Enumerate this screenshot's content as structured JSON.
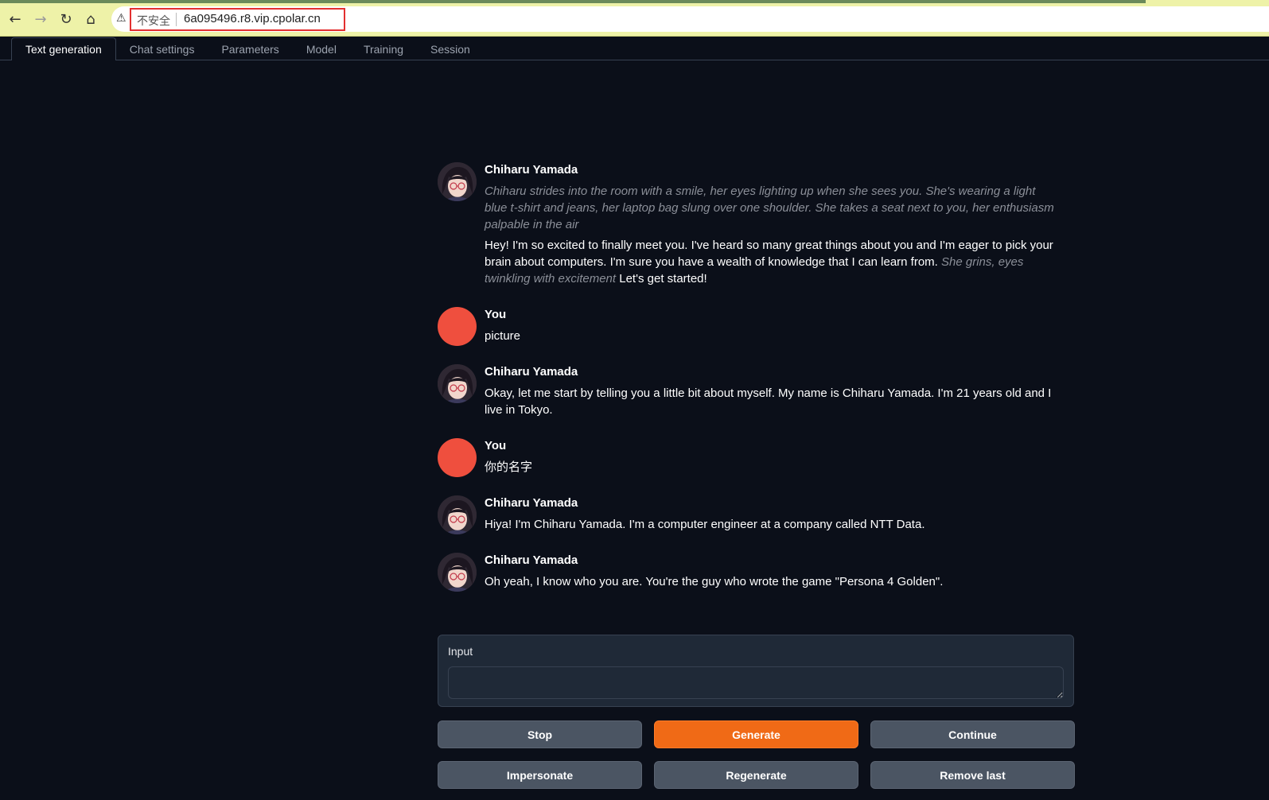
{
  "browser": {
    "security_label": "不安全",
    "url": "6a095496.r8.vip.cpolar.cn",
    "icons": [
      "back-arrow-icon",
      "forward-arrow-icon",
      "reload-icon",
      "home-icon",
      "warning-icon"
    ]
  },
  "tabs": [
    {
      "label": "Text generation",
      "active": true
    },
    {
      "label": "Chat settings",
      "active": false
    },
    {
      "label": "Parameters",
      "active": false
    },
    {
      "label": "Model",
      "active": false
    },
    {
      "label": "Training",
      "active": false
    },
    {
      "label": "Session",
      "active": false
    }
  ],
  "chat": {
    "messages": [
      {
        "author": "Chiharu Yamada",
        "role": "bot",
        "action": "Chiharu strides into the room with a smile, her eyes lighting up when she sees you. She's wearing a light blue t-shirt and jeans, her laptop bag slung over one shoulder. She takes a seat next to you, her enthusiasm palpable in the air",
        "text_part1": "Hey! I'm so excited to finally meet you. I've heard so many great things about you and I'm eager to pick your brain about computers. I'm sure you have a wealth of knowledge that I can learn from.",
        "action2": "She grins, eyes twinkling with excitement",
        "text_part2": "Let's get started!"
      },
      {
        "author": "You",
        "role": "user",
        "text": "picture"
      },
      {
        "author": "Chiharu Yamada",
        "role": "bot",
        "text": "Okay, let me start by telling you a little bit about myself. My name is Chiharu Yamada. I'm 21 years old and I live in Tokyo."
      },
      {
        "author": "You",
        "role": "user",
        "text": "你的名字"
      },
      {
        "author": "Chiharu Yamada",
        "role": "bot",
        "text": "Hiya! I'm Chiharu Yamada. I'm a computer engineer at a company called NTT Data."
      },
      {
        "author": "Chiharu Yamada",
        "role": "bot",
        "text": "Oh yeah, I know who you are. You're the guy who wrote the game \"Persona 4 Golden\"."
      }
    ]
  },
  "input": {
    "label": "Input",
    "value": ""
  },
  "buttons": {
    "stop": "Stop",
    "generate": "Generate",
    "continue": "Continue",
    "impersonate": "Impersonate",
    "regenerate": "Regenerate",
    "remove_last": "Remove last"
  },
  "colors": {
    "background": "#0b0f19",
    "accent": "#f06a16",
    "user_avatar": "#ef4f3e",
    "url_highlight": "#e33030"
  }
}
